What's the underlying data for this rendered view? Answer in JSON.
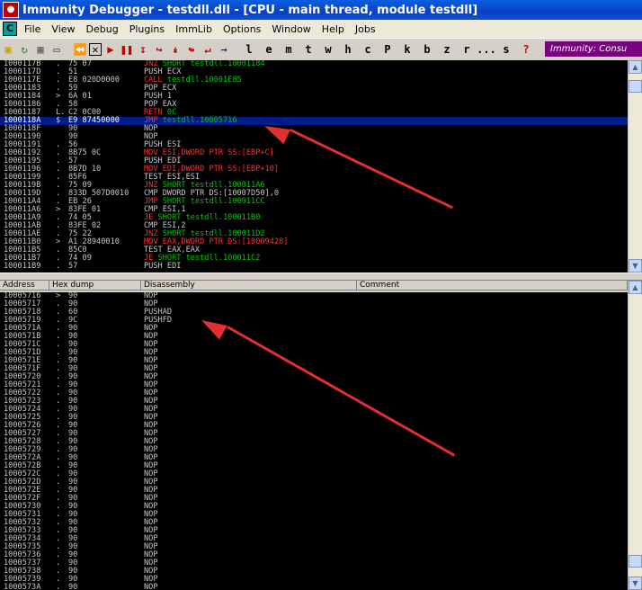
{
  "window": {
    "title": "Immunity Debugger - testdll.dll - [CPU - main thread, module testdll]"
  },
  "menu": [
    "File",
    "View",
    "Debug",
    "Plugins",
    "ImmLib",
    "Options",
    "Window",
    "Help",
    "Jobs"
  ],
  "toolbar": {
    "letters": [
      "l",
      "e",
      "m",
      "t",
      "w",
      "h",
      "c",
      "P",
      "k",
      "b",
      "z",
      "r",
      "...",
      "s",
      "?"
    ],
    "banner": "Immunity: Consu"
  },
  "colors": {
    "jcc": "#ff3030",
    "call": "#ff3030",
    "mov": "#ff3030",
    "text": "#c8c8c8",
    "addr_green": "#00c800",
    "selection": "#001b8a",
    "banner": "#7a0080",
    "arrow": "#e03030"
  },
  "cpu": {
    "rows": [
      {
        "addr": "1000117B",
        "mark": ".",
        "hex": "75 07",
        "mn": "JNZ",
        "ops": "SHORT testdll.10001184",
        "t": "jcc"
      },
      {
        "addr": "1000117D",
        "mark": ".",
        "hex": "51",
        "mn": "PUSH",
        "ops": "ECX",
        "t": "plain"
      },
      {
        "addr": "1000117E",
        "mark": ".",
        "hex": "E8 020D0000",
        "mn": "CALL",
        "ops": "testdll.10001E85",
        "t": "call"
      },
      {
        "addr": "10001183",
        "mark": ".",
        "hex": "59",
        "mn": "POP",
        "ops": "ECX",
        "t": "plain"
      },
      {
        "addr": "10001184",
        "mark": ">",
        "hex": "6A 01",
        "mn": "PUSH",
        "ops": "1",
        "t": "plain"
      },
      {
        "addr": "10001186",
        "mark": ".",
        "hex": "58",
        "mn": "POP",
        "ops": "EAX",
        "t": "plain"
      },
      {
        "addr": "10001187",
        "mark": "L.",
        "hex": "C2 0C00",
        "mn": "RETN",
        "ops": "0C",
        "t": "call"
      },
      {
        "addr": "1000118A",
        "mark": "$",
        "hex": "E9 87450000",
        "mn": "JMP",
        "ops": "testdll.10005716",
        "t": "jmp",
        "sel": true
      },
      {
        "addr": "1000118F",
        "mark": "",
        "hex": "90",
        "mn": "NOP",
        "ops": "",
        "t": "plain"
      },
      {
        "addr": "10001190",
        "mark": "",
        "hex": "90",
        "mn": "NOP",
        "ops": "",
        "t": "plain"
      },
      {
        "addr": "10001191",
        "mark": ".",
        "hex": "56",
        "mn": "PUSH",
        "ops": "ESI",
        "t": "plain"
      },
      {
        "addr": "10001192",
        "mark": ".",
        "hex": "8B75 0C",
        "mn": "MOV",
        "ops": "ESI,DWORD PTR SS:[EBP+C]",
        "t": "mov"
      },
      {
        "addr": "10001195",
        "mark": ".",
        "hex": "57",
        "mn": "PUSH",
        "ops": "EDI",
        "t": "plain"
      },
      {
        "addr": "10001196",
        "mark": ".",
        "hex": "8B7D 10",
        "mn": "MOV",
        "ops": "EDI,DWORD PTR SS:[EBP+10]",
        "t": "mov"
      },
      {
        "addr": "10001199",
        "mark": ".",
        "hex": "85F6",
        "mn": "TEST",
        "ops": "ESI,ESI",
        "t": "plain"
      },
      {
        "addr": "1000119B",
        "mark": ".",
        "hex": "75 09",
        "mn": "JNZ",
        "ops": "SHORT testdll.100011A6",
        "t": "jcc"
      },
      {
        "addr": "1000119D",
        "mark": ".",
        "hex": "833D 507D0010",
        "mn": "CMP",
        "ops": "DWORD PTR DS:[10007D50],0",
        "t": "plain"
      },
      {
        "addr": "100011A4",
        "mark": ".",
        "hex": "EB 26",
        "mn": "JMP",
        "ops": "SHORT testdll.100011CC",
        "t": "jcc"
      },
      {
        "addr": "100011A6",
        "mark": ">",
        "hex": "83FE 01",
        "mn": "CMP",
        "ops": "ESI,1",
        "t": "plain"
      },
      {
        "addr": "100011A9",
        "mark": ".",
        "hex": "74 05",
        "mn": "JE",
        "ops": "SHORT testdll.100011B0",
        "t": "jcc"
      },
      {
        "addr": "100011AB",
        "mark": ".",
        "hex": "83FE 02",
        "mn": "CMP",
        "ops": "ESI,2",
        "t": "plain"
      },
      {
        "addr": "100011AE",
        "mark": ".",
        "hex": "75 22",
        "mn": "JNZ",
        "ops": "SHORT testdll.100011D2",
        "t": "jcc"
      },
      {
        "addr": "100011B0",
        "mark": ">",
        "hex": "A1 28940010",
        "mn": "MOV",
        "ops": "EAX,DWORD PTR DS:[10009428]",
        "t": "mov"
      },
      {
        "addr": "100011B5",
        "mark": ".",
        "hex": "85C0",
        "mn": "TEST",
        "ops": "EAX,EAX",
        "t": "plain"
      },
      {
        "addr": "100011B7",
        "mark": ".",
        "hex": "74 09",
        "mn": "JE",
        "ops": "SHORT testdll.100011C2",
        "t": "jcc"
      },
      {
        "addr": "100011B9",
        "mark": ".",
        "hex": "57",
        "mn": "PUSH",
        "ops": "EDI",
        "t": "plain"
      }
    ]
  },
  "dump": {
    "headers": [
      "Address",
      "Hex dump",
      "Disassembly",
      "Comment"
    ],
    "rows": [
      {
        "addr": "10005716",
        "mark": ">",
        "hex": "90",
        "dis": "NOP"
      },
      {
        "addr": "10005717",
        "mark": ".",
        "hex": "90",
        "dis": "NOP"
      },
      {
        "addr": "10005718",
        "mark": ".",
        "hex": "60",
        "dis": "PUSHAD"
      },
      {
        "addr": "10005719",
        "mark": ".",
        "hex": "9C",
        "dis": "PUSHFD"
      },
      {
        "addr": "1000571A",
        "mark": ".",
        "hex": "90",
        "dis": "NOP"
      },
      {
        "addr": "1000571B",
        "mark": ".",
        "hex": "90",
        "dis": "NOP"
      },
      {
        "addr": "1000571C",
        "mark": ".",
        "hex": "90",
        "dis": "NOP"
      },
      {
        "addr": "1000571D",
        "mark": ".",
        "hex": "90",
        "dis": "NOP"
      },
      {
        "addr": "1000571E",
        "mark": ".",
        "hex": "90",
        "dis": "NOP"
      },
      {
        "addr": "1000571F",
        "mark": ".",
        "hex": "90",
        "dis": "NOP"
      },
      {
        "addr": "10005720",
        "mark": ".",
        "hex": "90",
        "dis": "NOP"
      },
      {
        "addr": "10005721",
        "mark": ".",
        "hex": "90",
        "dis": "NOP"
      },
      {
        "addr": "10005722",
        "mark": ".",
        "hex": "90",
        "dis": "NOP"
      },
      {
        "addr": "10005723",
        "mark": ".",
        "hex": "90",
        "dis": "NOP"
      },
      {
        "addr": "10005724",
        "mark": ".",
        "hex": "90",
        "dis": "NOP"
      },
      {
        "addr": "10005725",
        "mark": ".",
        "hex": "90",
        "dis": "NOP"
      },
      {
        "addr": "10005726",
        "mark": ".",
        "hex": "90",
        "dis": "NOP"
      },
      {
        "addr": "10005727",
        "mark": ".",
        "hex": "90",
        "dis": "NOP"
      },
      {
        "addr": "10005728",
        "mark": ".",
        "hex": "90",
        "dis": "NOP"
      },
      {
        "addr": "10005729",
        "mark": ".",
        "hex": "90",
        "dis": "NOP"
      },
      {
        "addr": "1000572A",
        "mark": ".",
        "hex": "90",
        "dis": "NOP"
      },
      {
        "addr": "1000572B",
        "mark": ".",
        "hex": "90",
        "dis": "NOP"
      },
      {
        "addr": "1000572C",
        "mark": ".",
        "hex": "90",
        "dis": "NOP"
      },
      {
        "addr": "1000572D",
        "mark": ".",
        "hex": "90",
        "dis": "NOP"
      },
      {
        "addr": "1000572E",
        "mark": ".",
        "hex": "90",
        "dis": "NOP"
      },
      {
        "addr": "1000572F",
        "mark": ".",
        "hex": "90",
        "dis": "NOP"
      },
      {
        "addr": "10005730",
        "mark": ".",
        "hex": "90",
        "dis": "NOP"
      },
      {
        "addr": "10005731",
        "mark": ".",
        "hex": "90",
        "dis": "NOP"
      },
      {
        "addr": "10005732",
        "mark": ".",
        "hex": "90",
        "dis": "NOP"
      },
      {
        "addr": "10005733",
        "mark": ".",
        "hex": "90",
        "dis": "NOP"
      },
      {
        "addr": "10005734",
        "mark": ".",
        "hex": "90",
        "dis": "NOP"
      },
      {
        "addr": "10005735",
        "mark": ".",
        "hex": "90",
        "dis": "NOP"
      },
      {
        "addr": "10005736",
        "mark": ".",
        "hex": "90",
        "dis": "NOP"
      },
      {
        "addr": "10005737",
        "mark": ".",
        "hex": "90",
        "dis": "NOP"
      },
      {
        "addr": "10005738",
        "mark": ".",
        "hex": "90",
        "dis": "NOP"
      },
      {
        "addr": "10005739",
        "mark": ".",
        "hex": "90",
        "dis": "NOP"
      },
      {
        "addr": "1000573A",
        "mark": ".",
        "hex": "90",
        "dis": "NOP"
      }
    ]
  }
}
